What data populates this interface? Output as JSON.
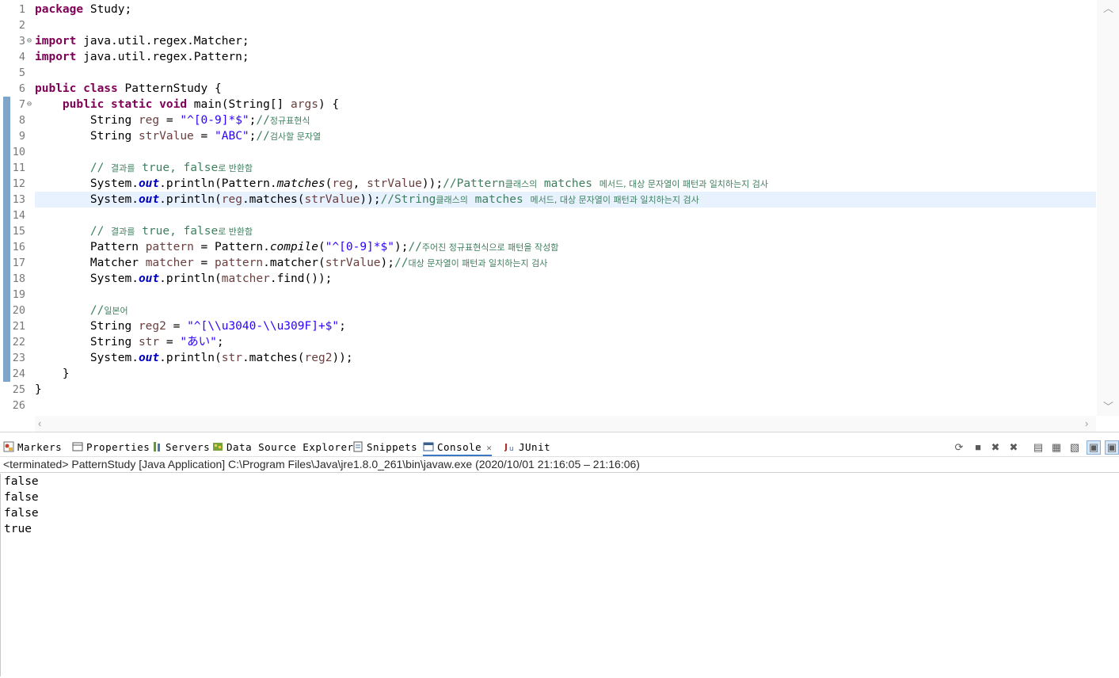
{
  "editor": {
    "line_numbers": [
      "1",
      "2",
      "3",
      "4",
      "5",
      "6",
      "7",
      "8",
      "9",
      "10",
      "11",
      "12",
      "13",
      "14",
      "15",
      "16",
      "17",
      "18",
      "19",
      "20",
      "21",
      "22",
      "23",
      "24",
      "25",
      "26"
    ],
    "code": {
      "l1_kw": "package",
      "l1_rest": " Study;",
      "l3_kw": "import",
      "l3_rest": " java.util.regex.Matcher;",
      "l4_kw": "import",
      "l4_rest": " java.util.regex.Pattern;",
      "l6_kw": "public class",
      "l6_rest": " PatternStudy {",
      "l7_kw": "public static void",
      "l7_rest": " main(String[] ",
      "l7_var": "args",
      "l7_end": ") {",
      "l8_a": "String ",
      "l8_var": "reg",
      "l8_b": " = ",
      "l8_str": "\"^[0-9]*$\"",
      "l8_c": ";",
      "l8_cm": "//",
      "l8_ko": "정규표현식",
      "l9_a": "String ",
      "l9_var": "strValue",
      "l9_b": " = ",
      "l9_str": "\"ABC\"",
      "l9_c": ";",
      "l9_cm": "//",
      "l9_ko": "검사할 문자열",
      "l11_cm": "// ",
      "l11_ko1": "결과를",
      "l11_cm2": " true, false",
      "l11_ko2": "로 반환함",
      "l12_a": "System.",
      "l12_out": "out",
      "l12_b": ".println(Pattern.",
      "l12_st": "matches",
      "l12_c": "(",
      "l12_v1": "reg",
      "l12_d": ", ",
      "l12_v2": "strValue",
      "l12_e": "));",
      "l12_cm1": "//Pattern",
      "l12_ko1": "클래스의",
      "l12_cm2": " matches ",
      "l12_ko2": "메서드, 대상 문자열이 패턴과 일치하는지 검사",
      "l13_a": "System.",
      "l13_out": "out",
      "l13_b": ".println(",
      "l13_v1": "reg",
      "l13_c": ".matches(",
      "l13_v2": "strValue",
      "l13_d": "));",
      "l13_cm1": "//String",
      "l13_ko1": "클래스의",
      "l13_cm2": " matches ",
      "l13_ko2": "메서드, 대상 문자열이 패턴과 일치하는지 검사",
      "l15_cm": "// ",
      "l15_ko1": "결과를",
      "l15_cm2": " true, false",
      "l15_ko2": "로 반환함",
      "l16_a": "Pattern ",
      "l16_var": "pattern",
      "l16_b": " = Pattern.",
      "l16_st": "compile",
      "l16_c": "(",
      "l16_str": "\"^[0-9]*$\"",
      "l16_d": ");",
      "l16_cm": "//",
      "l16_ko": "주어진 정규표현식으로 패턴을 작성함",
      "l17_a": "Matcher ",
      "l17_var": "matcher",
      "l17_b": " = ",
      "l17_v2": "pattern",
      "l17_c": ".matcher(",
      "l17_v3": "strValue",
      "l17_d": ");",
      "l17_cm": "//",
      "l17_ko": "대상 문자열이 패턴과 일치하는지 검사",
      "l18_a": "System.",
      "l18_out": "out",
      "l18_b": ".println(",
      "l18_var": "matcher",
      "l18_c": ".find());",
      "l20_cm": "//",
      "l20_ko": "일본어",
      "l21_a": "String ",
      "l21_var": "reg2",
      "l21_b": " = ",
      "l21_str": "\"^[\\\\u3040-\\\\u309F]+$\"",
      "l21_c": ";",
      "l22_a": "String ",
      "l22_var": "str",
      "l22_b": " = ",
      "l22_str": "\"あい\"",
      "l22_c": ";",
      "l23_a": "System.",
      "l23_out": "out",
      "l23_b": ".println(",
      "l23_v1": "str",
      "l23_c": ".matches(",
      "l23_v2": "reg2",
      "l23_d": "));",
      "l24": "}",
      "l25": "}"
    }
  },
  "panel": {
    "tabs": {
      "markers": "Markers",
      "properties": "Properties",
      "servers": "Servers",
      "data_source": "Data Source Explorer",
      "snippets": "Snippets",
      "console": "Console",
      "junit": "JUnit"
    },
    "console_header": "<terminated> PatternStudy [Java Application] C:\\Program Files\\Java\\jre1.8.0_261\\bin\\javaw.exe  (2020/10/01 21:16:05 – 21:16:06)",
    "output": [
      "false",
      "false",
      "false",
      "true"
    ]
  },
  "colors": {
    "keyword": "#7f0055",
    "string": "#2a00ff",
    "comment": "#3f7f5f",
    "field": "#0000c0",
    "current_line": "#e8f2fe",
    "active_tab": "#3a78c4"
  }
}
